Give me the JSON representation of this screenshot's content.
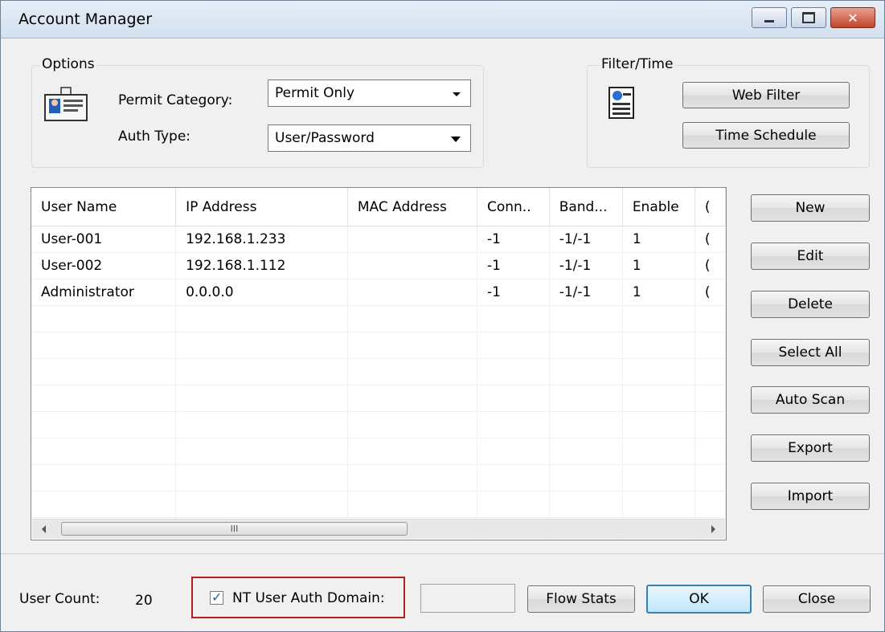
{
  "window": {
    "title": "Account Manager"
  },
  "options": {
    "group_title": "Options",
    "permit_category_label": "Permit Category:",
    "permit_category_value": "Permit Only",
    "auth_type_label": "Auth Type:",
    "auth_type_value": "User/Password"
  },
  "filter": {
    "group_title": "Filter/Time",
    "web_filter_label": "Web Filter",
    "time_schedule_label": "Time Schedule"
  },
  "table": {
    "columns": [
      "User Name",
      "IP Address",
      "MAC Address",
      "Conn..",
      "Band...",
      "Enable",
      "("
    ],
    "rows": [
      [
        "User-001",
        "192.168.1.233",
        "",
        "-1",
        "-1/-1",
        "1",
        "("
      ],
      [
        "User-002",
        "192.168.1.112",
        "",
        "-1",
        "-1/-1",
        "1",
        "("
      ],
      [
        "Administrator",
        "0.0.0.0",
        "",
        "-1",
        "-1/-1",
        "1",
        "("
      ]
    ],
    "scroll_grip": "III"
  },
  "side_buttons": {
    "new": "New",
    "edit": "Edit",
    "delete": "Delete",
    "select_all": "Select All",
    "auto_scan": "Auto Scan",
    "export": "Export",
    "import": "Import"
  },
  "footer": {
    "user_count_label": "User Count:",
    "user_count_value": "20",
    "nt_auth_label": "NT User Auth Domain:",
    "nt_auth_checked": true,
    "nt_domain_value": "",
    "flow_stats_label": "Flow Stats",
    "ok_label": "OK",
    "close_label": "Close"
  }
}
